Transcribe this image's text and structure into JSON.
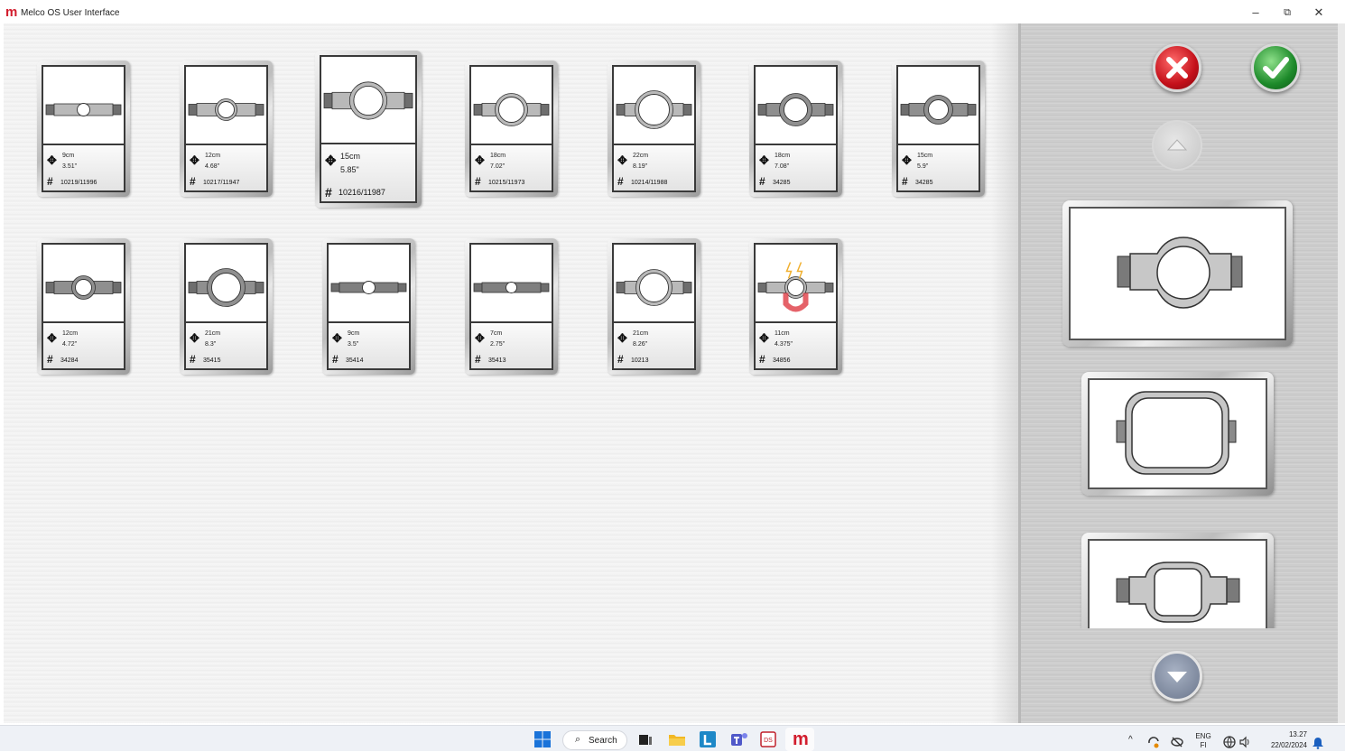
{
  "window": {
    "title": "Melco OS User Interface",
    "logo_letter": "m",
    "minimize": "–",
    "maximize": "⧉",
    "close": "✕"
  },
  "hoops": [
    {
      "dim_cm": "9cm",
      "dim_in": "3.51\"",
      "part": "10219/11996",
      "shape": "small-round",
      "selected": false
    },
    {
      "dim_cm": "12cm",
      "dim_in": "4.68\"",
      "part": "10217/11947",
      "shape": "round-12",
      "selected": false
    },
    {
      "dim_cm": "15cm",
      "dim_in": "5.85\"",
      "part": "10216/11987",
      "shape": "round-15",
      "selected": true
    },
    {
      "dim_cm": "18cm",
      "dim_in": "7.02\"",
      "part": "10215/11973",
      "shape": "round-18",
      "selected": false
    },
    {
      "dim_cm": "22cm",
      "dim_in": "8.19\"",
      "part": "10214/11988",
      "shape": "round-22",
      "selected": false
    },
    {
      "dim_cm": "18cm",
      "dim_in": "7.08\"",
      "part": "34285",
      "shape": "round-18-thick",
      "selected": false
    },
    {
      "dim_cm": "15cm",
      "dim_in": "5.9\"",
      "part": "34285",
      "shape": "round-15-thick",
      "selected": false
    },
    {
      "dim_cm": "12cm",
      "dim_in": "4.72\"",
      "part": "34284",
      "shape": "round-12-thick",
      "selected": false
    },
    {
      "dim_cm": "21cm",
      "dim_in": "8.3\"",
      "part": "35415",
      "shape": "round-21-thick",
      "selected": false
    },
    {
      "dim_cm": "9cm",
      "dim_in": "3.5\"",
      "part": "35414",
      "shape": "small-dark",
      "selected": false
    },
    {
      "dim_cm": "7cm",
      "dim_in": "2.75\"",
      "part": "35413",
      "shape": "tiny-dark",
      "selected": false
    },
    {
      "dim_cm": "21cm",
      "dim_in": "8.26\"",
      "part": "10213",
      "shape": "round-21",
      "selected": false
    },
    {
      "dim_cm": "11cm",
      "dim_in": "4.375\"",
      "part": "34856",
      "shape": "magnetic",
      "selected": false
    }
  ],
  "side_panel": {
    "cancel_icon": "close-icon",
    "ok_icon": "checkmark-icon",
    "scroll_up_icon": "chevron-up-icon",
    "scroll_down_icon": "chevron-down-icon",
    "hoop_types": [
      "round-hoop",
      "rectangular-hoop",
      "square-hoop"
    ]
  },
  "taskbar": {
    "search_label": "Search",
    "language": "ENG",
    "region": "FI",
    "time": "13.27",
    "date": "22/02/2024"
  },
  "colors": {
    "brand": "#d21d2d",
    "cancel": "#c4101a",
    "ok": "#1d8a2a"
  }
}
